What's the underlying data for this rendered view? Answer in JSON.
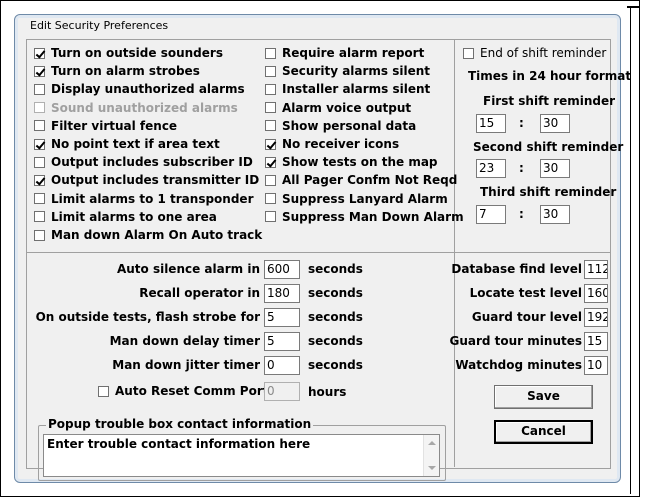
{
  "window": {
    "title": "Edit Security Preferences"
  },
  "options_col1": [
    {
      "label": "Turn on outside sounders",
      "checked": true,
      "disabled": false
    },
    {
      "label": "Turn on alarm strobes",
      "checked": true,
      "disabled": false
    },
    {
      "label": "Display unauthorized alarms",
      "checked": false,
      "disabled": false
    },
    {
      "label": "Sound unauthorized alarms",
      "checked": false,
      "disabled": true
    },
    {
      "label": "Filter virtual fence",
      "checked": false,
      "disabled": false
    },
    {
      "label": "No point text if area text",
      "checked": true,
      "disabled": false
    },
    {
      "label": "Output includes subscriber ID",
      "checked": false,
      "disabled": false
    },
    {
      "label": "Output includes transmitter ID",
      "checked": true,
      "disabled": false
    },
    {
      "label": "Limit alarms to 1 transponder",
      "checked": false,
      "disabled": false
    },
    {
      "label": "Limit alarms to one area",
      "checked": false,
      "disabled": false
    },
    {
      "label": "Man down Alarm On Auto track",
      "checked": false,
      "disabled": false
    }
  ],
  "options_col2": [
    {
      "label": "Require alarm report",
      "checked": false
    },
    {
      "label": "Security alarms silent",
      "checked": false
    },
    {
      "label": "Installer alarms silent",
      "checked": false
    },
    {
      "label": "Alarm voice output",
      "checked": false
    },
    {
      "label": "Show personal data",
      "checked": false
    },
    {
      "label": "No receiver icons",
      "checked": true
    },
    {
      "label": "Show tests on the map",
      "checked": true
    },
    {
      "label": "All Pager Confm Not Reqd",
      "checked": false
    },
    {
      "label": "Suppress Lanyard Alarm",
      "checked": false
    },
    {
      "label": "Suppress Man Down Alarm",
      "checked": false
    }
  ],
  "shift": {
    "end_of_shift_label": "End of shift reminder",
    "end_of_shift_checked": false,
    "format_note": "Times in 24 hour format",
    "first_label": "First shift reminder",
    "first_hour": "15",
    "first_min": "30",
    "second_label": "Second shift reminder",
    "second_hour": "23",
    "second_min": "30",
    "third_label": "Third shift reminder",
    "third_hour": "7",
    "third_min": "30",
    "colon": ":"
  },
  "timers": [
    {
      "label": "Auto silence alarm in",
      "value": "600",
      "unit": "seconds"
    },
    {
      "label": "Recall operator in",
      "value": "180",
      "unit": "seconds"
    },
    {
      "label": "On outside tests, flash strobe for",
      "value": "5",
      "unit": "seconds"
    },
    {
      "label": "Man down delay timer",
      "value": "5",
      "unit": "seconds"
    },
    {
      "label": "Man down jitter timer",
      "value": "0",
      "unit": "seconds"
    }
  ],
  "auto_reset": {
    "label": "Auto Reset Comm Ports",
    "checked": false,
    "value": "0",
    "unit": "hours"
  },
  "levels": [
    {
      "label": "Database find level",
      "value": "112"
    },
    {
      "label": "Locate test level",
      "value": "160"
    },
    {
      "label": "Guard tour level",
      "value": "192"
    },
    {
      "label": "Guard tour minutes",
      "value": "15"
    },
    {
      "label": "Watchdog minutes",
      "value": "10"
    }
  ],
  "popup": {
    "legend": "Popup trouble box contact information",
    "text": "Enter trouble contact information here"
  },
  "buttons": {
    "save": "Save",
    "cancel": "Cancel"
  }
}
